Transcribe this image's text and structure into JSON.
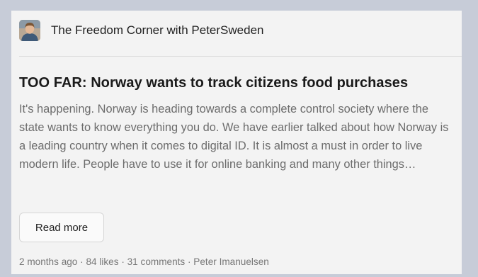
{
  "publication": {
    "name": "The Freedom Corner with PeterSweden"
  },
  "post": {
    "title": "TOO FAR: Norway wants to track citizens food purchases",
    "excerpt": "It's happening. Norway is heading towards a complete control society where the state wants to know everything you do. We have earlier talked about how Norway is a leading country when it comes to digital ID. It is almost a must in order to live modern life. People have to use it for online banking and many other things…",
    "read_more_label": "Read more",
    "meta": "2 months ago · 84 likes · 31 comments · Peter Imanuelsen"
  }
}
